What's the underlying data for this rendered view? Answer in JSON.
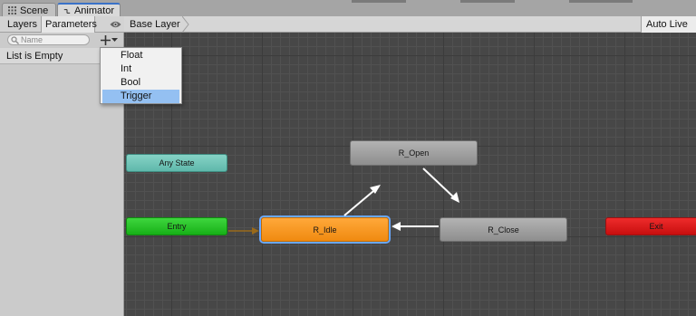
{
  "tabs": [
    {
      "label": "Scene",
      "icon": "grid-icon"
    },
    {
      "label": "Animator",
      "icon": "animator-icon"
    }
  ],
  "left_panel": {
    "subtabs": {
      "layers": "Layers",
      "parameters": "Parameters"
    },
    "search_placeholder": "Name",
    "empty_text": "List is Empty"
  },
  "graph": {
    "breadcrumb": "Base Layer",
    "auto_live": "Auto Live Li",
    "nodes": {
      "any_state": "Any State",
      "entry": "Entry",
      "idle": "R_Idle",
      "open": "R_Open",
      "close": "R_Close",
      "exit": "Exit"
    }
  },
  "param_type_menu": {
    "items": [
      "Float",
      "Int",
      "Bool",
      "Trigger"
    ],
    "selected": "Trigger"
  },
  "colors": {
    "idle_state": "#f08a10",
    "entry_state": "#17b017",
    "exit_state": "#c80f0f",
    "any_state": "#5fb8ab",
    "selection_blue": "#94c0f2",
    "tab_accent": "#3a72c8"
  }
}
